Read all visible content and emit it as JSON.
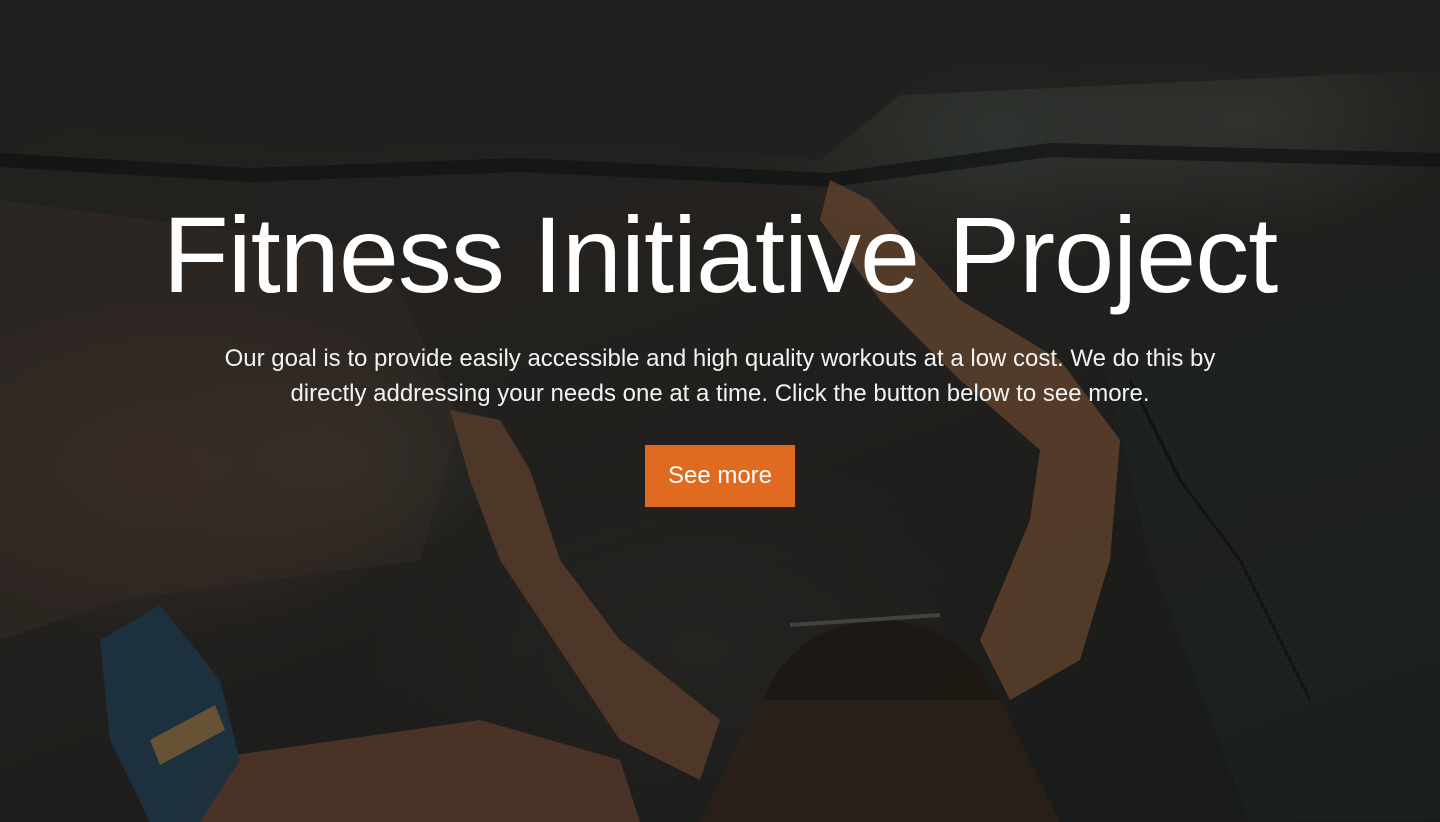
{
  "hero": {
    "title": "Fitness Initiative Project",
    "subtitle": "Our goal is to provide easily accessible and high quality workouts at a low cost. We do this by directly addressing your needs one at a time. Click the button below to see more.",
    "cta_label": "See more",
    "background_image": "rock-climber-photo"
  },
  "colors": {
    "accent": "#e06a20",
    "text": "#ffffff"
  }
}
